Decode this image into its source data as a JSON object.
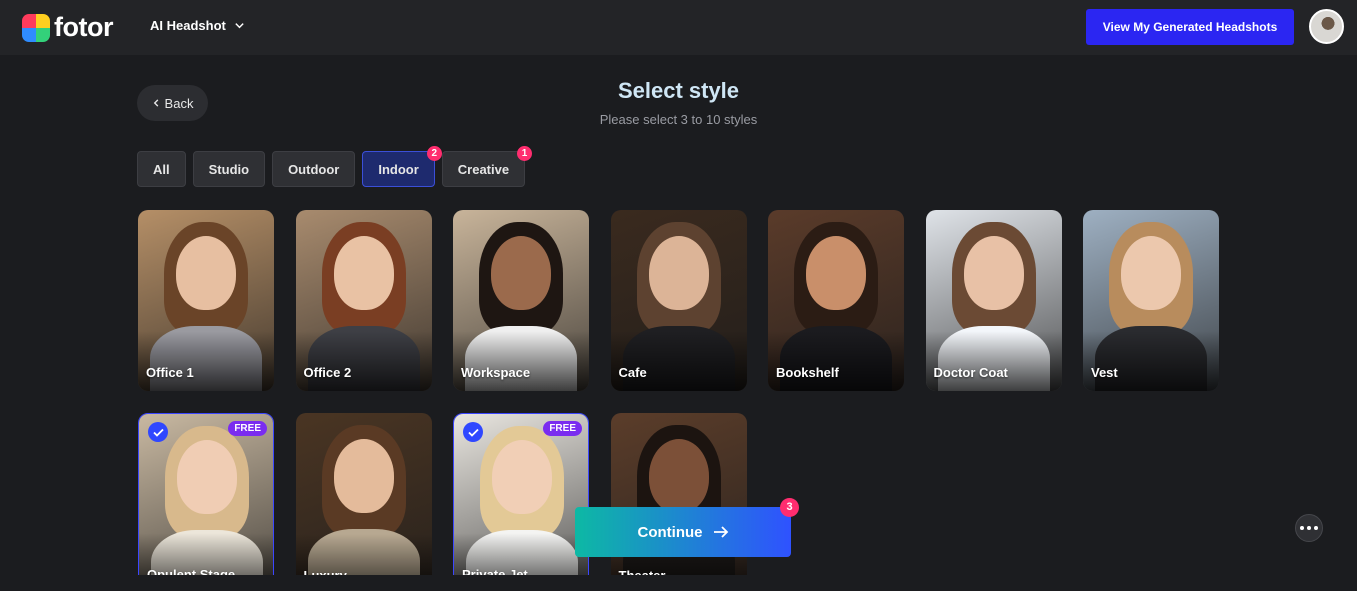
{
  "header": {
    "logo_text": "fotor",
    "product_label": "AI Headshot",
    "view_button_label": "View My Generated Headshots",
    "accent": "#2b26f2"
  },
  "page": {
    "back_label": "Back",
    "title": "Select style",
    "subtitle": "Please select 3 to 10 styles"
  },
  "tabs": [
    {
      "label": "All",
      "badge": ""
    },
    {
      "label": "Studio",
      "badge": ""
    },
    {
      "label": "Outdoor",
      "badge": ""
    },
    {
      "label": "Indoor",
      "badge": "2",
      "active": true
    },
    {
      "label": "Creative",
      "badge": "1"
    }
  ],
  "styles": [
    {
      "label": "Office 1",
      "selected": false,
      "free": false
    },
    {
      "label": "Office 2",
      "selected": false,
      "free": false
    },
    {
      "label": "Workspace",
      "selected": false,
      "free": false
    },
    {
      "label": "Cafe",
      "selected": false,
      "free": false
    },
    {
      "label": "Bookshelf",
      "selected": false,
      "free": false
    },
    {
      "label": "Doctor Coat",
      "selected": false,
      "free": false
    },
    {
      "label": "Vest",
      "selected": false,
      "free": false
    },
    {
      "label": "Opulent Stage",
      "selected": true,
      "free": true
    },
    {
      "label": "Luxury",
      "selected": false,
      "free": false
    },
    {
      "label": "Private Jet",
      "selected": true,
      "free": true
    },
    {
      "label": "Theater",
      "selected": false,
      "free": false
    }
  ],
  "free_badge": "FREE",
  "continue": {
    "label": "Continue",
    "badge": "3"
  },
  "icons": {
    "back": "chevron-left-icon",
    "dropdown": "chevron-down-icon",
    "continue": "arrow-right-icon",
    "more": "more-horizontal-icon",
    "check": "check-icon"
  }
}
